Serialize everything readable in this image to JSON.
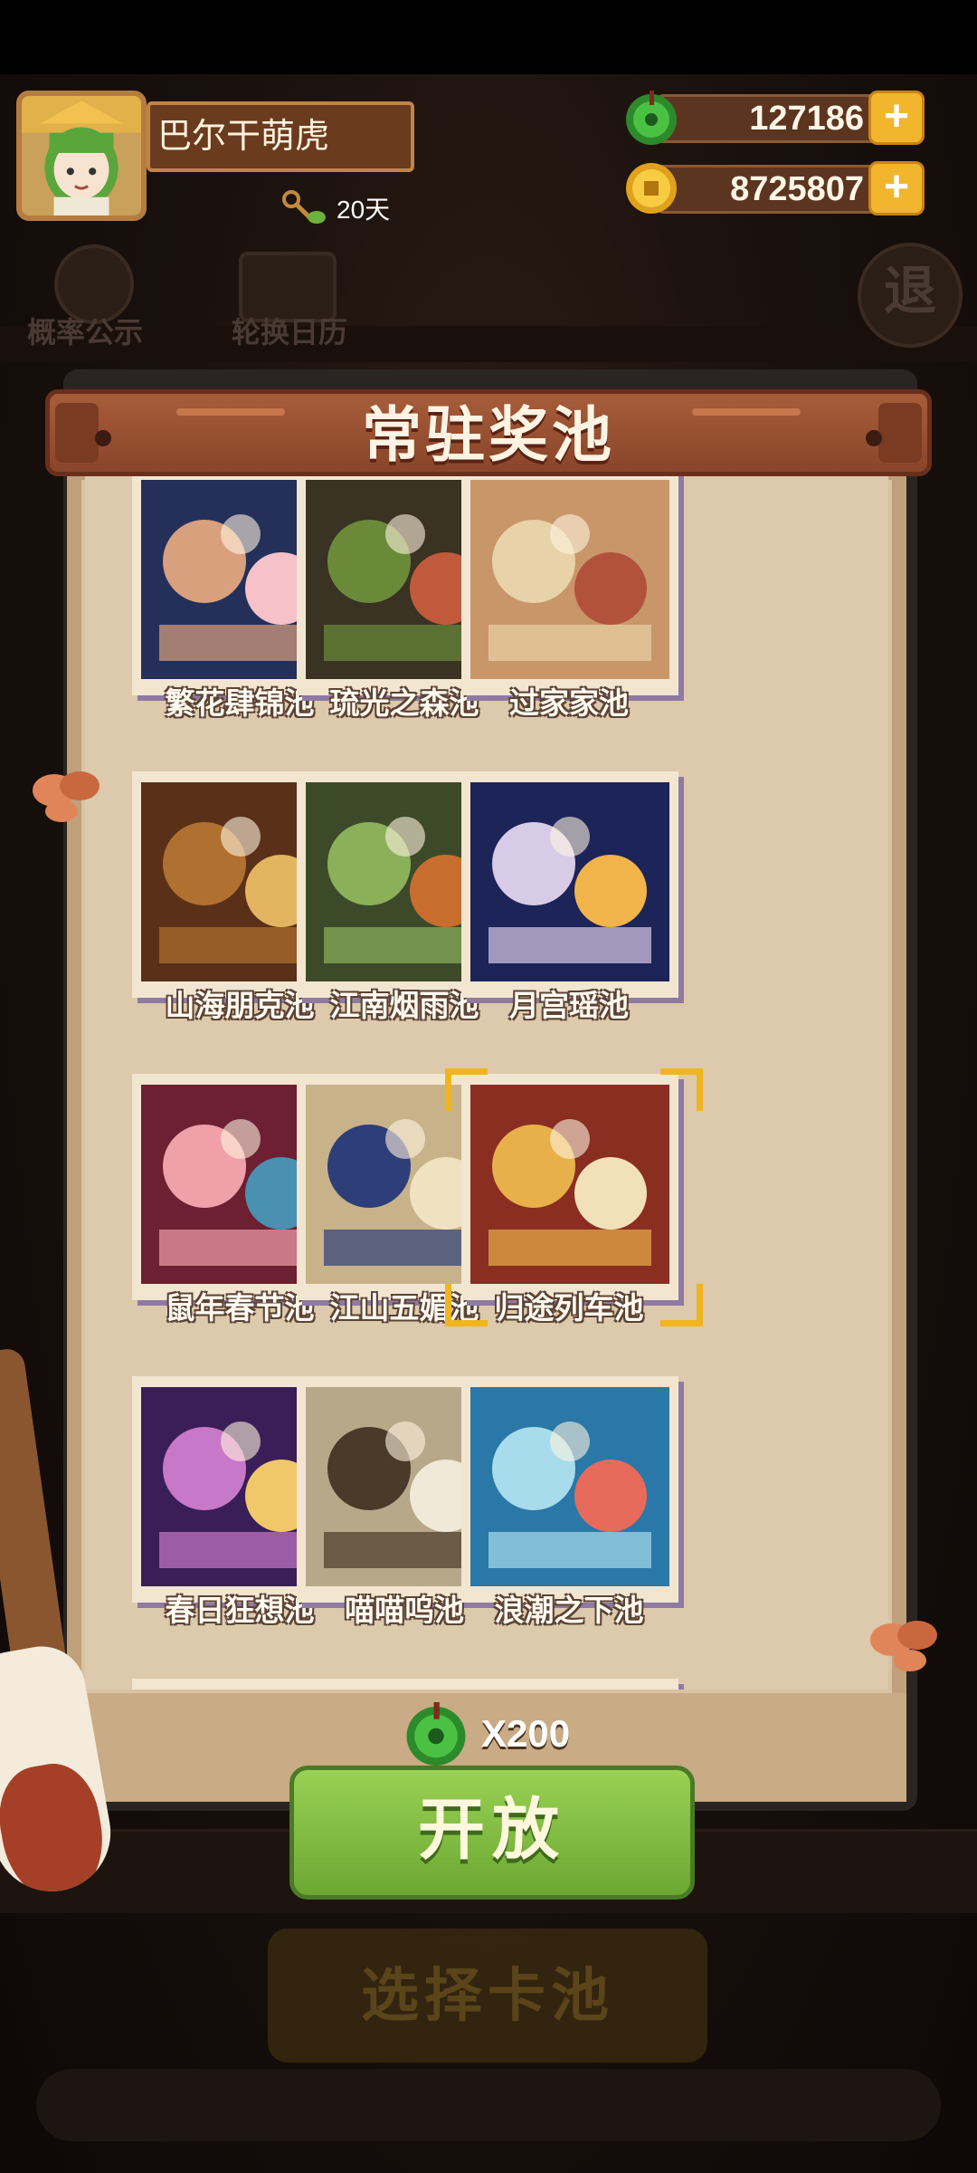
{
  "header": {
    "player_name": "巴尔干萌虎",
    "days": "20天",
    "currencies": [
      {
        "name": "jade",
        "value": "127186",
        "plus": "+"
      },
      {
        "name": "coin",
        "value": "8725807",
        "plus": "+"
      }
    ],
    "background_buttons": {
      "probability": "概率公示",
      "calendar": "轮换日历",
      "exit": "退"
    }
  },
  "panel": {
    "title": "常驻奖池",
    "pools": [
      {
        "label": "繁花肆锦池"
      },
      {
        "label": "琉光之森池"
      },
      {
        "label": "过家家池"
      },
      {
        "label": "山海朋克池"
      },
      {
        "label": "江南烟雨池"
      },
      {
        "label": "月宫瑶池"
      },
      {
        "label": "鼠年春节池"
      },
      {
        "label": "江山五媚池"
      },
      {
        "label": "归途列车池",
        "selected": true
      },
      {
        "label": "春日狂想池"
      },
      {
        "label": "喵喵呜池"
      },
      {
        "label": "浪潮之下池"
      }
    ],
    "cost": "X200",
    "open_label": "开放"
  },
  "background": {
    "select_pool": "选择卡池"
  },
  "colors": {
    "accent_green": "#7bb83d",
    "gold": "#f2b52e",
    "banner": "#9b5233"
  }
}
